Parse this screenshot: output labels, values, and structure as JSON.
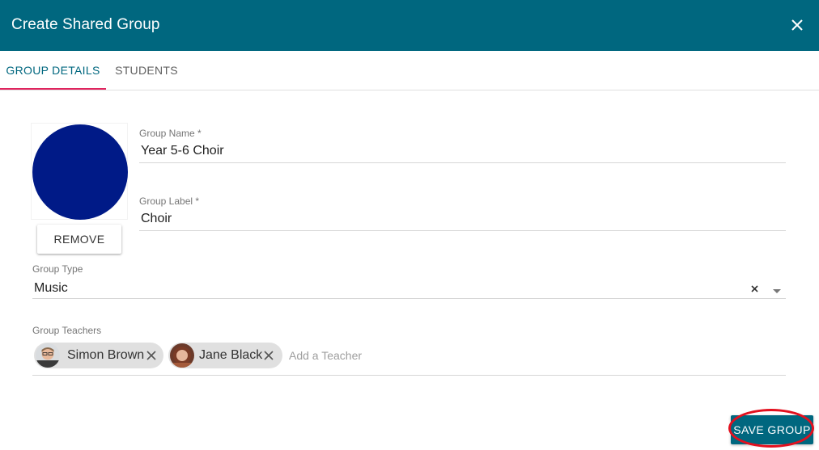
{
  "dialog": {
    "title": "Create Shared Group",
    "close_icon": "close-icon"
  },
  "tabs": [
    {
      "label": "GROUP DETAILS",
      "active": true
    },
    {
      "label": "STUDENTS",
      "active": false
    }
  ],
  "avatar": {
    "color": "#001a87",
    "remove_label": "REMOVE"
  },
  "fields": {
    "group_name": {
      "label": "Group Name *",
      "value": "Year 5-6 Choir"
    },
    "group_label": {
      "label": "Group Label *",
      "value": "Choir"
    },
    "group_type": {
      "label": "Group Type",
      "value": "Music",
      "clear_icon": "clear-icon",
      "dropdown_icon": "dropdown-arrow-icon"
    },
    "group_teachers": {
      "label": "Group Teachers",
      "teachers": [
        {
          "name": "Simon Brown"
        },
        {
          "name": "Jane Black"
        }
      ],
      "add_placeholder": "Add a Teacher"
    }
  },
  "actions": {
    "save_label": "SAVE GROUP"
  },
  "colors": {
    "header": "#00677f",
    "tab_indicator": "#e0245e",
    "highlight": "#e3101e"
  }
}
